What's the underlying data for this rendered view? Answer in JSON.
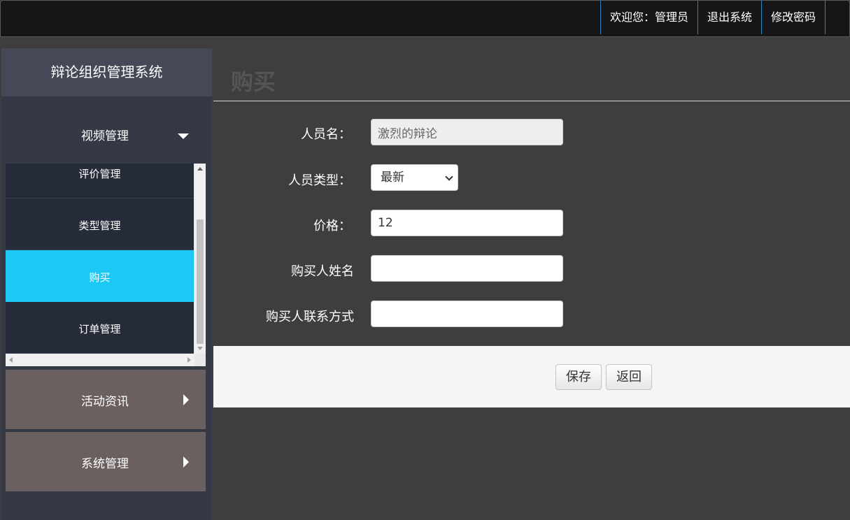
{
  "topbar": {
    "welcome": "欢迎您：管理员",
    "logout": "退出系统",
    "change_password": "修改密码"
  },
  "sidebar": {
    "brand": "辩论组织管理系统",
    "video_menu": {
      "label": "视频管理",
      "items": [
        {
          "label": "评价管理"
        },
        {
          "label": "类型管理"
        },
        {
          "label": "购买",
          "active": true
        },
        {
          "label": "订单管理"
        }
      ]
    },
    "activity_menu": {
      "label": "活动资讯"
    },
    "system_menu": {
      "label": "系统管理"
    }
  },
  "main": {
    "title": "购买",
    "form": {
      "person_name": {
        "label": "人员名：",
        "value": "激烈的辩论"
      },
      "person_type": {
        "label": "人员类型：",
        "value": "最新"
      },
      "price": {
        "label": "价格：",
        "value": "12"
      },
      "buyer_name": {
        "label": "购买人姓名",
        "value": ""
      },
      "buyer_contact": {
        "label": "购买人联系方式",
        "value": ""
      }
    },
    "buttons": {
      "save": "保存",
      "back": "返回"
    }
  },
  "colors": {
    "active_item": "#1ec8f5",
    "topbar_bg": "#161616",
    "content_bg": "#3e3e3e"
  }
}
